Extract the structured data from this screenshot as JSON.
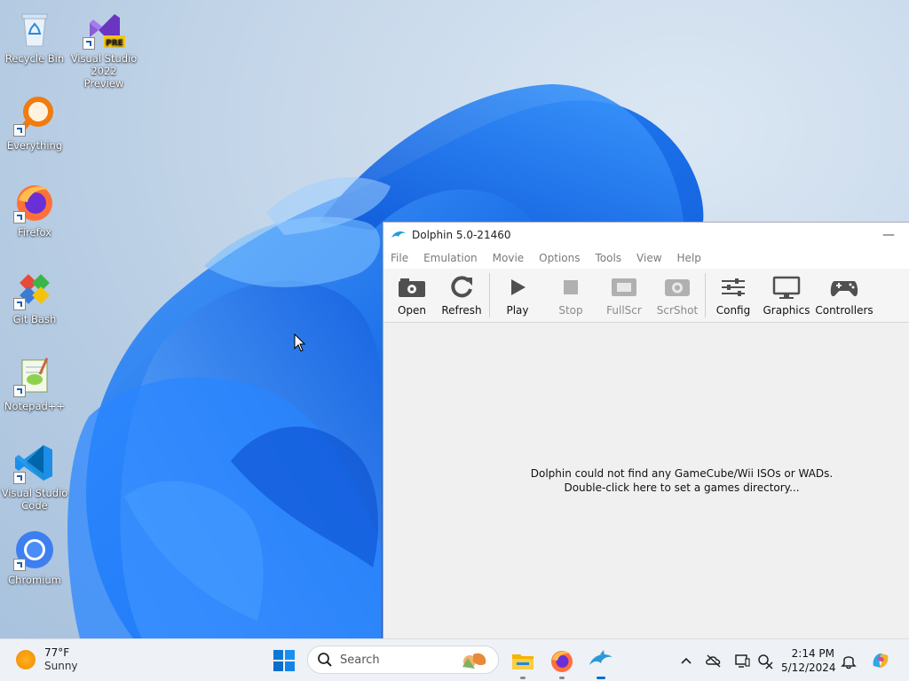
{
  "desktop": {
    "icons": [
      {
        "label": "Recycle Bin",
        "icon": "recycle-bin-icon"
      },
      {
        "label": "Visual Studio 2022 Preview",
        "line1": "Visual Studio",
        "line2": "2022 Preview",
        "badge": "PRE",
        "icon": "visual-studio-icon"
      },
      {
        "label": "Everything",
        "icon": "everything-search-icon"
      },
      {
        "label": "Firefox",
        "icon": "firefox-icon"
      },
      {
        "label": "Git Bash",
        "icon": "git-bash-icon"
      },
      {
        "label": "Notepad++",
        "icon": "notepadpp-icon"
      },
      {
        "label": "Visual Studio Code",
        "line1": "Visual Studio",
        "line2": "Code",
        "icon": "vscode-icon"
      },
      {
        "label": "Chromium",
        "icon": "chromium-icon"
      }
    ]
  },
  "window": {
    "title": "Dolphin 5.0-21460",
    "minimize_glyph": "—",
    "menu": [
      "File",
      "Emulation",
      "Movie",
      "Options",
      "Tools",
      "View",
      "Help"
    ],
    "toolbar": [
      {
        "label": "Open",
        "icon": "open-icon",
        "enabled": true
      },
      {
        "label": "Refresh",
        "icon": "refresh-icon",
        "enabled": true
      },
      {
        "label": "Play",
        "icon": "play-icon",
        "enabled": true
      },
      {
        "label": "Stop",
        "icon": "stop-icon",
        "enabled": false
      },
      {
        "label": "FullScr",
        "icon": "fullscreen-icon",
        "enabled": false
      },
      {
        "label": "ScrShot",
        "icon": "screenshot-icon",
        "enabled": false
      },
      {
        "label": "Config",
        "icon": "config-icon",
        "enabled": true
      },
      {
        "label": "Graphics",
        "icon": "graphics-icon",
        "enabled": true
      },
      {
        "label": "Controllers",
        "icon": "controllers-icon",
        "enabled": true
      }
    ],
    "empty_message_line1": "Dolphin could not find any GameCube/Wii ISOs or WADs.",
    "empty_message_line2": "Double-click here to set a games directory..."
  },
  "taskbar": {
    "weather": {
      "temp": "77°F",
      "condition": "Sunny"
    },
    "search_placeholder": "Search",
    "pinned": [
      "file-explorer-icon",
      "firefox-icon",
      "dolphin-icon"
    ],
    "clock": {
      "time": "2:14 PM",
      "date": "5/12/2024"
    }
  },
  "colors": {
    "bloom_primary": "#1a73e8",
    "window_bg": "#f0f0f0",
    "taskbar_bg": "#eef1f6"
  }
}
